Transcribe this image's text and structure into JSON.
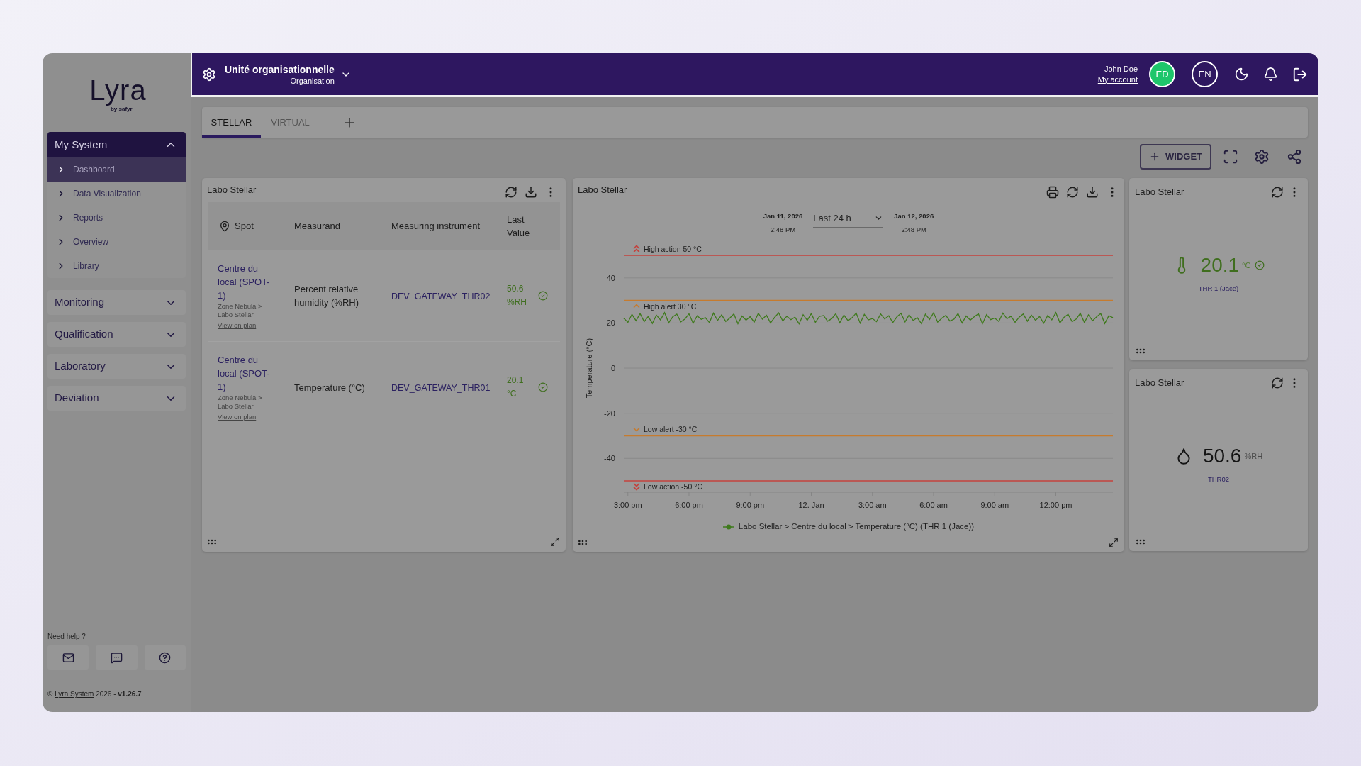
{
  "sidebar": {
    "logo": {
      "name": "Lyra",
      "tagline": "by safyr"
    },
    "sections": [
      {
        "label": "My System",
        "expanded": true,
        "children": [
          {
            "label": "Dashboard",
            "selected": true
          },
          {
            "label": "Data Visualization",
            "selected": false
          },
          {
            "label": "Reports",
            "selected": false
          },
          {
            "label": "Overview",
            "selected": false
          },
          {
            "label": "Library",
            "selected": false
          }
        ]
      },
      {
        "label": "Monitoring",
        "expanded": false
      },
      {
        "label": "Qualification",
        "expanded": false
      },
      {
        "label": "Laboratory",
        "expanded": false
      },
      {
        "label": "Deviation",
        "expanded": false
      }
    ],
    "help": {
      "label": "Need help ?"
    },
    "footer": {
      "symbol": "©",
      "link": "Lyra System",
      "suffix": "2026 - **v1.26.7**"
    }
  },
  "header": {
    "title": "Unité organisationnelle",
    "subtitle": "Organisation",
    "user": {
      "name": "John Doe",
      "link": "My account",
      "initials": "ED"
    },
    "language": "EN"
  },
  "tabs": [
    {
      "label": "STELLAR",
      "selected": true
    },
    {
      "label": "VIRTUAL",
      "selected": false
    }
  ],
  "toolbar": {
    "add_button": "WIDGET"
  },
  "widgets": {
    "table": {
      "title": "Labo Stellar",
      "columns": [
        "Spot",
        "Measurand",
        "Measuring instrument",
        "Last Value"
      ],
      "rows": [
        {
          "spot": "Centre du local (SPOT-1)",
          "location": "Zone Nebula > Labo Stellar",
          "link": "View on plan",
          "measurand": "Percent relative humidity (%RH)",
          "instrument": "DEV_GATEWAY_THR02",
          "value": "50.6 %RH",
          "ok": true
        },
        {
          "spot": "Centre du local (SPOT-1)",
          "location": "Zone Nebula > Labo Stellar",
          "link": "View on plan",
          "measurand": "Temperature (°C)",
          "instrument": "DEV_GATEWAY_THR01",
          "value": "20.1 °C",
          "ok": true
        }
      ]
    },
    "chart": {
      "title": "Labo Stellar",
      "range": {
        "start_date": "Jan 11, 2026",
        "start_time": "2:48 PM",
        "period": "Last 24 h",
        "end_date": "Jan 12, 2026",
        "end_time": "2:48 PM"
      },
      "chart_data": {
        "type": "line",
        "ylabel": "Temperature (°C)",
        "categories": [
          null,
          "3:00 pm",
          null,
          null,
          null,
          null,
          null,
          null,
          null,
          null,
          null,
          null,
          null,
          null,
          null,
          null,
          "6:00 pm",
          null,
          null,
          null,
          null,
          null,
          null,
          null,
          null,
          null,
          null,
          null,
          null,
          null,
          null,
          "9:00 pm",
          null,
          null,
          null,
          null,
          null,
          null,
          null,
          null,
          null,
          null,
          null,
          null,
          null,
          null,
          "12. Jan",
          null,
          null,
          null,
          null,
          null,
          null,
          null,
          null,
          null,
          null,
          null,
          null,
          null,
          null,
          "3:00 am",
          null,
          null,
          null,
          null,
          null,
          null,
          null,
          null,
          null,
          null,
          null,
          null,
          null,
          null,
          "6:00 am",
          null,
          null,
          null,
          null,
          null,
          null,
          null,
          null,
          null,
          null,
          null,
          null,
          null,
          null,
          "9:00 am",
          null,
          null,
          null,
          null,
          null,
          null,
          null,
          null,
          null,
          null,
          null,
          null,
          null,
          null,
          "12:00 pm",
          null,
          null,
          null,
          null,
          null,
          null,
          null,
          null,
          null,
          null,
          null,
          null,
          null,
          null
        ],
        "series": [
          {
            "name": "Labo Stellar > Centre du local > Temperature (°C) (THR 1 (Jace))",
            "color": "#3f7a1c",
            "values": [
              22.1,
              20.3,
              23.8,
              21.0,
              24.2,
              20.6,
              22.9,
              19.8,
              23.5,
              21.4,
              24.6,
              20.1,
              22.7,
              23.9,
              20.5,
              21.8,
              24.1,
              19.9,
              23.2,
              21.6,
              22.4,
              20.2,
              24.4,
              21.1,
              23.6,
              20.7,
              22.2,
              24.0,
              19.7,
              23.1,
              21.3,
              22.8,
              20.4,
              24.3,
              21.7,
              23.4,
              20.0,
              22.5,
              24.5,
              20.9,
              23.0,
              21.5,
              22.6,
              19.6,
              23.7,
              21.2,
              24.2,
              20.3,
              22.9,
              23.3,
              20.8,
              21.9,
              24.1,
              20.1,
              23.5,
              21.0,
              22.3,
              24.4,
              19.9,
              23.8,
              21.4,
              22.0,
              20.6,
              24.0,
              21.8,
              23.2,
              20.2,
              22.7,
              24.3,
              20.5,
              23.6,
              21.1,
              22.4,
              19.8,
              23.9,
              21.6,
              24.5,
              20.4,
              22.1,
              23.4,
              20.9,
              21.7,
              24.2,
              20.0,
              23.1,
              21.3,
              22.8,
              24.1,
              19.7,
              23.7,
              21.5,
              22.2,
              20.7,
              24.4,
              21.9,
              23.0,
              20.3,
              22.6,
              24.0,
              20.8,
              23.5,
              21.2,
              22.9,
              19.9,
              23.3,
              21.4,
              24.6,
              20.1,
              22.5,
              23.8,
              20.6,
              21.8,
              24.3,
              20.2,
              23.6,
              21.0,
              22.7,
              24.2,
              19.8,
              23.2,
              22.4
            ]
          }
        ],
        "ylim": [
          -55,
          50
        ],
        "yticks": [
          -40,
          -20,
          0,
          20,
          40
        ],
        "grid": true,
        "ref_lines": [
          {
            "axis": "y",
            "value": 50,
            "label": "High action 50 °C",
            "color": "#c4423d"
          },
          {
            "axis": "y",
            "value": 30,
            "label": "High alert 30 °C",
            "color": "#c67b2e"
          },
          {
            "axis": "y",
            "value": -30,
            "label": "Low alert -30 °C",
            "color": "#c67b2e"
          },
          {
            "axis": "y",
            "value": -50,
            "label": "Low action -50 °C",
            "color": "#c4423d"
          }
        ]
      }
    },
    "tiles": [
      {
        "title": "Labo Stellar",
        "kind": "temperature",
        "value": "20.1",
        "unit": "°C",
        "sensor": "THR 1 (Jace)",
        "ok": true
      },
      {
        "title": "Labo Stellar",
        "kind": "humidity",
        "value": "50.6",
        "unit": "%RH",
        "sensor": "THR02",
        "ok": false
      }
    ]
  }
}
